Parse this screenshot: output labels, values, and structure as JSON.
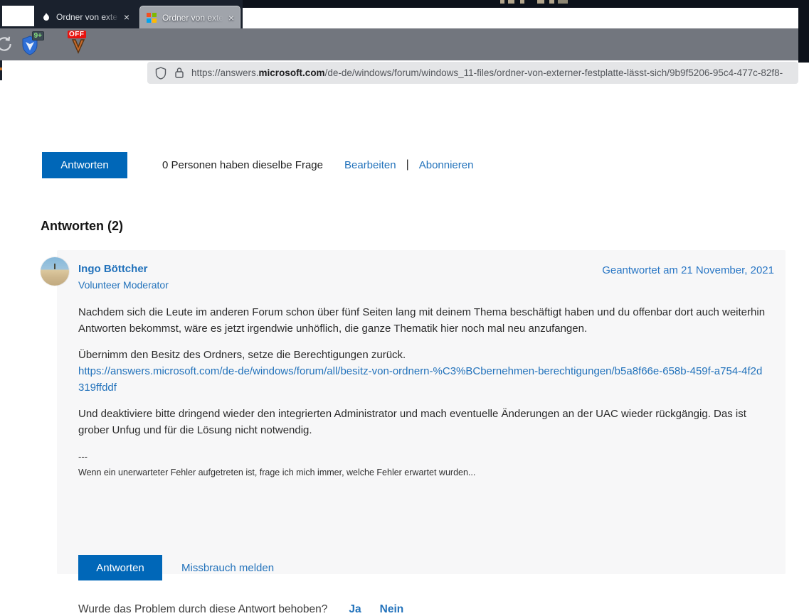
{
  "browser": {
    "tabs": [
      {
        "title": "Ordner von exte",
        "close": "×",
        "icon": "flame-icon"
      },
      {
        "title": "Ordner von exte",
        "close": "×",
        "icon": "microsoft-logo-icon"
      }
    ],
    "extensions": [
      {
        "name": "shield-extension",
        "badge": "9+"
      },
      {
        "name": "downloader-extension",
        "badge": "OFF"
      }
    ],
    "url": {
      "prefix": "https://answers.",
      "domain": "microsoft.com",
      "path": "/de-de/windows/forum/windows_11-files/ordner-von-externer-festplatte-lässt-sich/9b9f5206-95c4-477c-82f8-"
    }
  },
  "page": {
    "reply_button": "Antworten",
    "same_question": "0 Personen haben dieselbe Frage",
    "edit_link": "Bearbeiten",
    "link_separator": "|",
    "subscribe_link": "Abonnieren",
    "answers_heading": "Antworten (2)",
    "answer": {
      "author": "Ingo Böttcher",
      "role": "Volunteer Moderator",
      "date": "Geantwortet am 21 November, 2021",
      "paragraph1": "Nachdem sich die Leute im anderen Forum schon über fünf Seiten lang mit deinem Thema beschäftigt haben und du offenbar dort auch weiterhin Antworten bekommst, wäre es jetzt irgendwie unhöflich, die ganze Thematik hier noch mal neu anzufangen.",
      "paragraph2": "Übernimm den Besitz des Ordners, setze die Berechtigungen zurück.",
      "link": "https://answers.microsoft.com/de-de/windows/forum/all/besitz-von-ordnern-%C3%BCbernehmen-berechtigungen/b5a8f66e-658b-459f-a754-4f2d319ffddf",
      "paragraph3": "Und deaktiviere bitte dringend wieder den integrierten Administrator und mach eventuelle Änderungen an der UAC wieder rückgängig. Das ist grober Unfug und für die Lösung nicht notwendig.",
      "divider": "---",
      "signature": "Wenn ein unerwarteter Fehler aufgetreten ist, frage ich mich immer, welche Fehler erwartet wurden...",
      "reply_button": "Antworten",
      "report_link": "Missbrauch melden",
      "helpful_question": "Wurde das Problem durch diese Antwort behoben?",
      "yes_link": "Ja",
      "no_link": "Nein"
    }
  },
  "colors": {
    "accent_blue": "#0067b8",
    "link_blue": "#2272bb",
    "toolbar_gray": "#72767e",
    "tabbar_dark": "#1a212d",
    "card_background": "#f7f7f8"
  }
}
